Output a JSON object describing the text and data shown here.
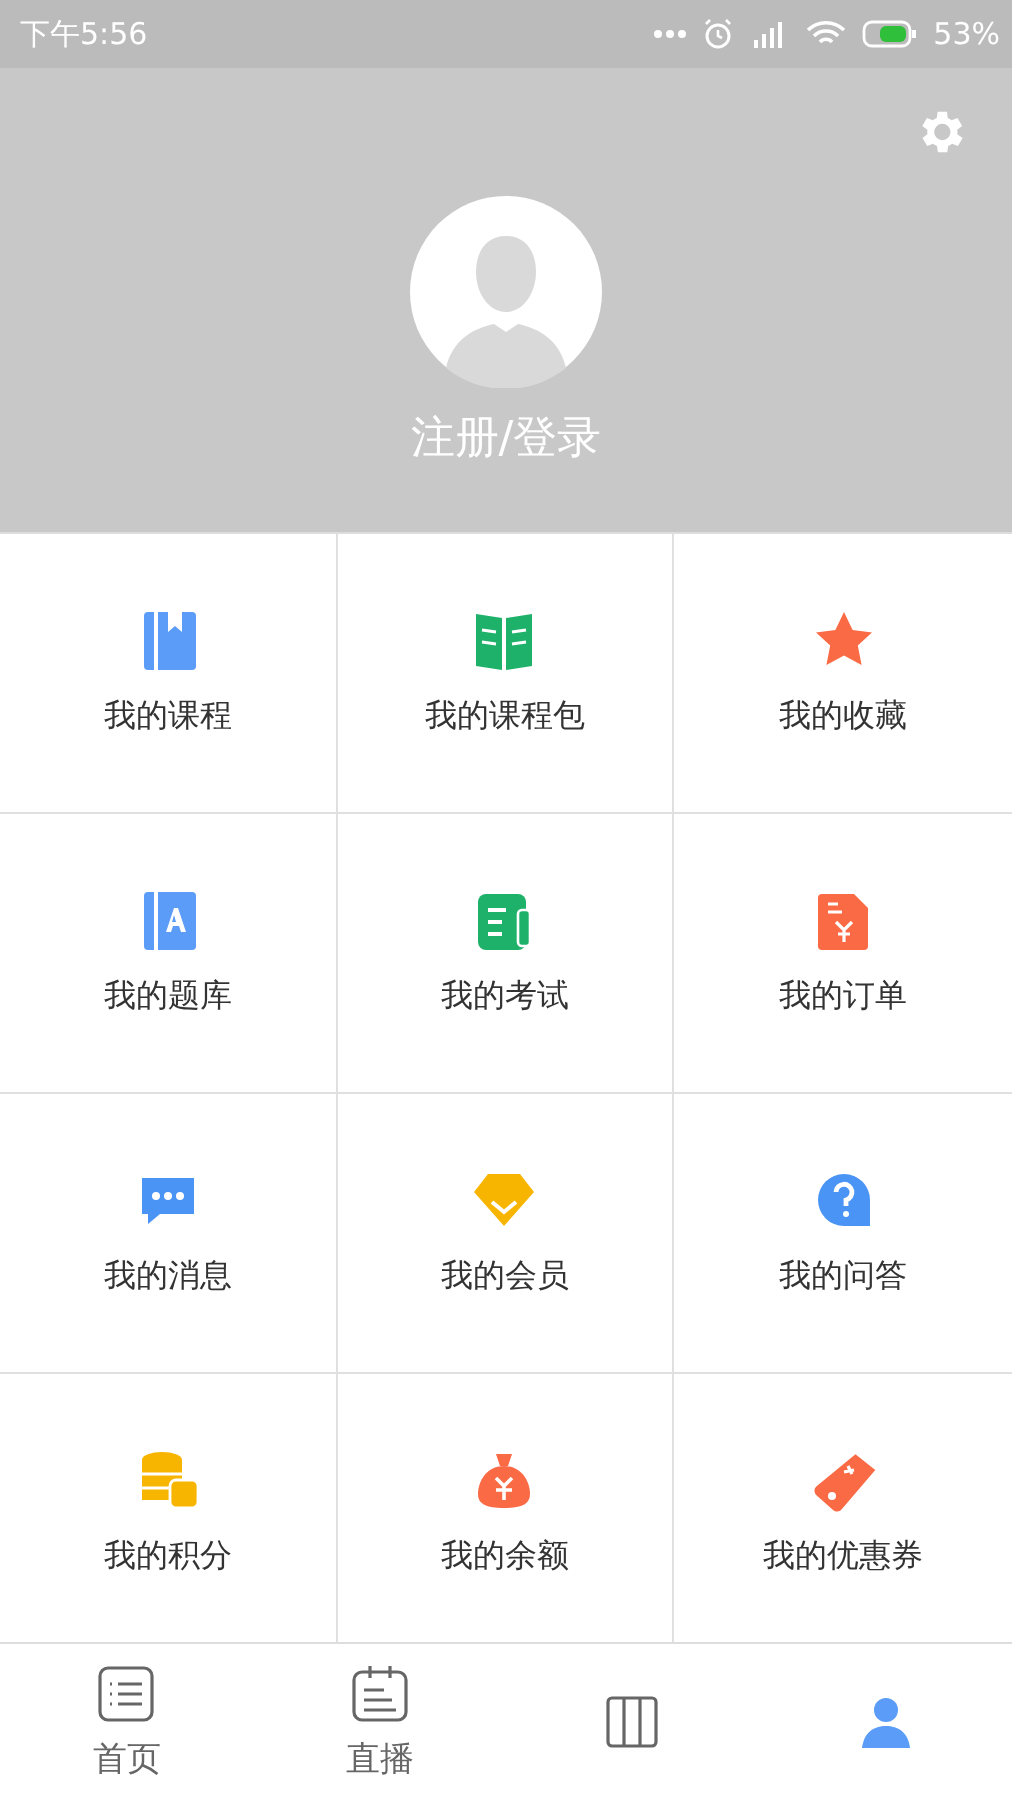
{
  "status_bar": {
    "time": "下午5:56",
    "battery": "53%"
  },
  "profile": {
    "login_label": "注册/登录"
  },
  "menu": [
    {
      "label": "我的课程",
      "kind": "course"
    },
    {
      "label": "我的课程包",
      "kind": "package"
    },
    {
      "label": "我的收藏",
      "kind": "favorite"
    },
    {
      "label": "我的题库",
      "kind": "bank"
    },
    {
      "label": "我的考试",
      "kind": "exam"
    },
    {
      "label": "我的订单",
      "kind": "order"
    },
    {
      "label": "我的消息",
      "kind": "message"
    },
    {
      "label": "我的会员",
      "kind": "member"
    },
    {
      "label": "我的问答",
      "kind": "qa"
    },
    {
      "label": "我的积分",
      "kind": "points"
    },
    {
      "label": "我的余额",
      "kind": "balance"
    },
    {
      "label": "我的优惠券",
      "kind": "coupon"
    }
  ],
  "tab_bar": [
    {
      "label": "首页",
      "kind": "home",
      "selected": false
    },
    {
      "label": "直播",
      "kind": "live",
      "selected": false
    },
    {
      "kind": "course",
      "selected": false
    },
    {
      "kind": "me",
      "selected": true
    }
  ]
}
